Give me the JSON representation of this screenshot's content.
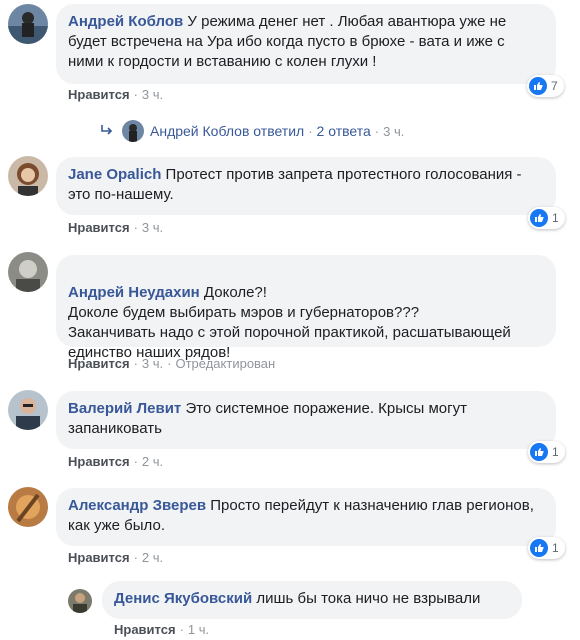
{
  "comments": [
    {
      "author": "Андрей Коблов",
      "text": "У режима денег нет . Любая авантюра уже не будет встречена на Ура ибо когда пусто в брюхе - вата и иже с ними к гордости и вставанию с колен глухи !",
      "like_label": "Нравится",
      "time": "3 ч.",
      "reaction_count": "7",
      "replies": {
        "author": "Андрей Коблов",
        "action": "ответил",
        "count_label": "2 ответа",
        "time": "3 ч."
      }
    },
    {
      "author": "Jane Opalich",
      "text": "Протест против запрета протестного голосования - это по-нашему.",
      "like_label": "Нравится",
      "time": "3 ч.",
      "reaction_count": "1"
    },
    {
      "author": "Андрей Неудахин",
      "text": "Доколе?!\nДоколе будем выбирать мэров и губернаторов???\nЗаканчивать надо с этой порочной практикой, расшатывающей единство наших рядов!",
      "like_label": "Нравится",
      "time": "3 ч.",
      "edited": "Отредактирован"
    },
    {
      "author": "Валерий Левит",
      "text": "Это системное поражение. Крысы могут запаниковать",
      "like_label": "Нравится",
      "time": "2 ч.",
      "reaction_count": "1"
    },
    {
      "author": "Александр Зверев",
      "text": "Просто перейдут к назначению глав регионов, как уже было.",
      "like_label": "Нравится",
      "time": "2 ч.",
      "reaction_count": "1"
    },
    {
      "author": "Денис Якубовский",
      "text": "лишь бы тока ничо не взрывали",
      "like_label": "Нравится",
      "time": "1 ч."
    }
  ],
  "colors": {
    "author": "#385898",
    "bubble": "#f2f3f5",
    "meta": "#90949c",
    "like_badge": "#1877f2"
  }
}
